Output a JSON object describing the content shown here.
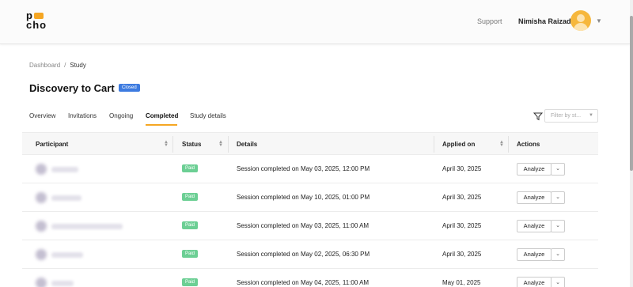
{
  "header": {
    "logo_line1": "p",
    "logo_line2": "cho",
    "support_label": "Support",
    "user_name": "Nimisha Raizada"
  },
  "breadcrumb": {
    "items": [
      "Dashboard",
      "Study"
    ]
  },
  "study": {
    "title": "Discovery to Cart",
    "status_badge": "Closed"
  },
  "tabs": [
    {
      "label": "Overview",
      "active": false
    },
    {
      "label": "Invitations",
      "active": false
    },
    {
      "label": "Ongoing",
      "active": false
    },
    {
      "label": "Completed",
      "active": true
    },
    {
      "label": "Study details",
      "active": false
    }
  ],
  "filter": {
    "placeholder": "Filter by st..."
  },
  "table": {
    "columns": [
      "Participant",
      "Status",
      "Details",
      "Applied on",
      "Actions"
    ],
    "rows": [
      {
        "status": "Paid",
        "details": "Session completed on May 03, 2025, 12:00 PM",
        "applied_on": "April 30, 2025",
        "action": "Analyze"
      },
      {
        "status": "Paid",
        "details": "Session completed on May 10, 2025, 01:00 PM",
        "applied_on": "April 30, 2025",
        "action": "Analyze"
      },
      {
        "status": "Paid",
        "details": "Session completed on May 03, 2025, 11:00 AM",
        "applied_on": "April 30, 2025",
        "action": "Analyze"
      },
      {
        "status": "Paid",
        "details": "Session completed on May 02, 2025, 06:30 PM",
        "applied_on": "April 30, 2025",
        "action": "Analyze"
      },
      {
        "status": "Paid",
        "details": "Session completed on May 04, 2025, 11:00 AM",
        "applied_on": "May 01, 2025",
        "action": "Analyze"
      }
    ]
  },
  "colors": {
    "accent": "#f5a623",
    "closed_badge": "#3d7be0",
    "paid_badge": "#6ccf94"
  }
}
